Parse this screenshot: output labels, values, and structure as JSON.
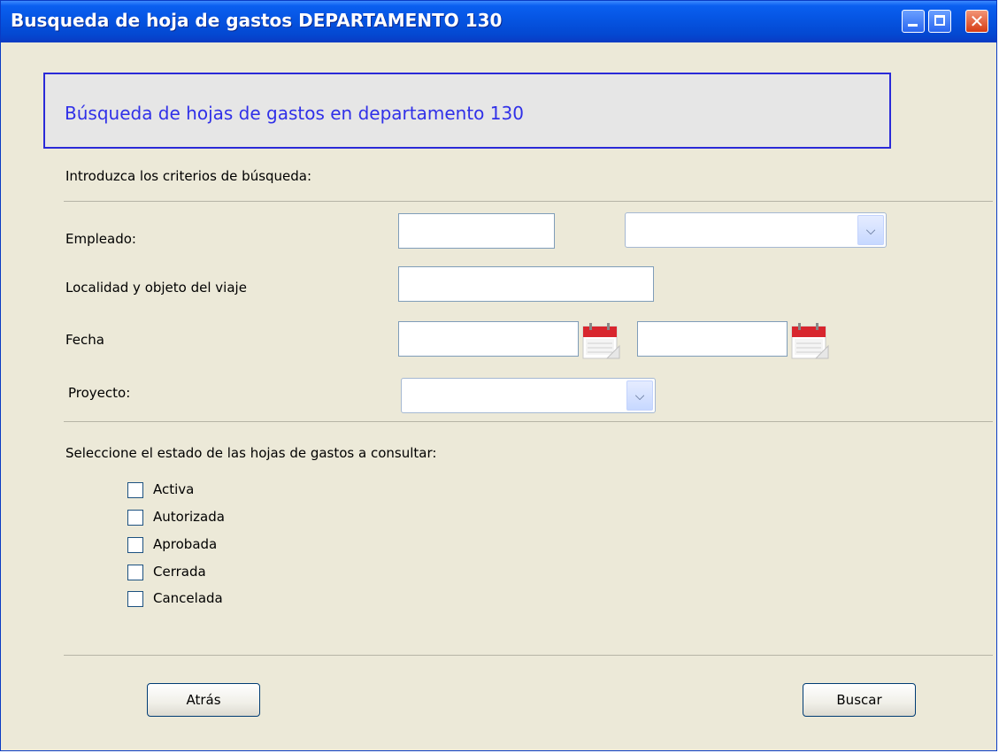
{
  "window": {
    "title": "Busqueda de hoja de gastos DEPARTAMENTO 130",
    "controls": {
      "minimize": "minimize",
      "maximize": "maximize",
      "close": "✕"
    }
  },
  "banner": {
    "text": "Búsqueda de hojas de gastos en departamento 130"
  },
  "criteria": {
    "heading": "Introduzca los criterios de búsqueda:",
    "empleado": {
      "label": "Empleado:",
      "code_value": "",
      "select_value": ""
    },
    "localidad": {
      "label": "Localidad y objeto del viaje",
      "value": ""
    },
    "fecha": {
      "label": "Fecha",
      "from_value": "",
      "to_value": ""
    },
    "proyecto": {
      "label": "Proyecto:",
      "select_value": ""
    }
  },
  "states": {
    "heading": "Seleccione el estado de las hojas de gastos a consultar:",
    "options": [
      {
        "label": "Activa",
        "checked": false
      },
      {
        "label": "Autorizada",
        "checked": false
      },
      {
        "label": "Aprobada",
        "checked": false
      },
      {
        "label": "Cerrada",
        "checked": false
      },
      {
        "label": "Cancelada",
        "checked": false
      }
    ]
  },
  "buttons": {
    "back": "Atrás",
    "search": "Buscar"
  },
  "icons": {
    "date_picker": "calendar-icon",
    "dropdown": "chevron-down-icon"
  },
  "colors": {
    "titlebar": "#0553e0",
    "banner_border": "#2a2ad8",
    "banner_text": "#3030e8",
    "window_bg": "#ece9d8"
  }
}
